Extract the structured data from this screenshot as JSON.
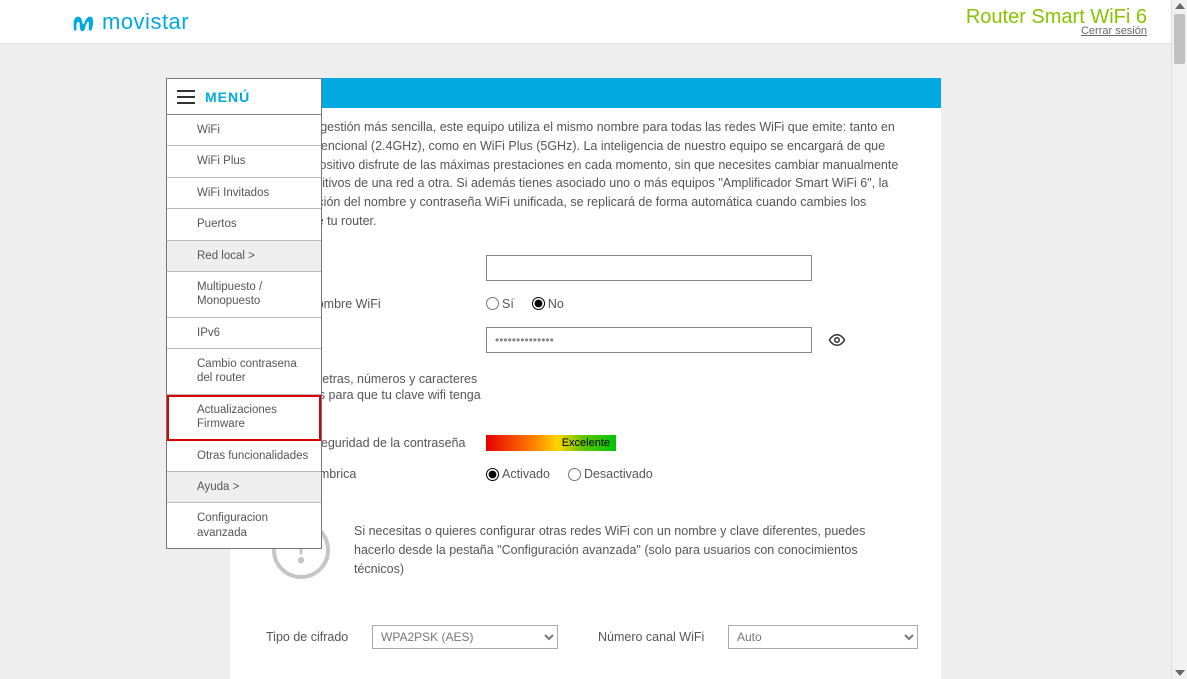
{
  "header": {
    "brand": "movistar",
    "router_title": "Router Smart WiFi 6",
    "logout_label": "Cerrar sesión"
  },
  "menu": {
    "title": "MENÚ",
    "items": [
      {
        "label": "WiFi",
        "shaded": false
      },
      {
        "label": "WiFi Plus",
        "shaded": false
      },
      {
        "label": "WiFi Invitados",
        "shaded": false
      },
      {
        "label": "Puertos",
        "shaded": false
      },
      {
        "label": "Red local >",
        "shaded": true
      },
      {
        "label": "Multipuesto / Monopuesto",
        "shaded": false
      },
      {
        "label": "IPv6",
        "shaded": false
      },
      {
        "label": "Cambio contrasena del router",
        "shaded": false
      },
      {
        "label": "Actualizaciones Firmware",
        "shaded": false,
        "highlight": true
      },
      {
        "label": "Otras funcionalidades",
        "shaded": false
      },
      {
        "label": "Ayuda >",
        "shaded": true
      },
      {
        "label": "Configuracion avanzada",
        "shaded": false
      }
    ]
  },
  "intro": {
    "text": "Para una gestión más sencilla, este equipo utiliza el mismo nombre para todas las redes WiFi que emite: tanto en WiFi convencional (2.4GHz), como en WiFi Plus (5GHz). La inteligencia de nuestro equipo se encargará de que cada dispositivo disfrute de las máximas prestaciones en cada momento, sin que necesites cambiar manualmente tus dispositivos de una red a otra.\nSi además tienes asociado uno o más equipos \"Amplificador Smart WiFi 6\", la configuración del nombre y contraseña WiFi unificada, se replicará de forma automática cuando cambies los valores de tu router."
  },
  "form": {
    "name_value": "",
    "hide_label": "Ocultar nombre WiFi",
    "hide_options": {
      "yes": "Sí",
      "no": "No"
    },
    "password_value": "••••••••••••••",
    "password_hint_label": "Combina letras, números y caracteres especiales para que tu clave wifi tenga seguridad",
    "strength_label": "Nivel de seguridad de la contraseña",
    "strength_value": "Excelente",
    "wireless_label": "Red inalámbrica",
    "wireless_options": {
      "on": "Activado",
      "off": "Desactivado"
    }
  },
  "info": {
    "text": "Si necesitas o quieres configurar otras redes WiFi con un nombre y clave diferentes, puedes hacerlo desde la pestaña \"Configuración avanzada\" (solo para usuarios con conocimientos técnicos)"
  },
  "bottom": {
    "cipher_label": "Tipo de cifrado",
    "cipher_value": "WPA2PSK (AES)",
    "channel_label": "Número canal WiFi",
    "channel_value": "Auto"
  }
}
